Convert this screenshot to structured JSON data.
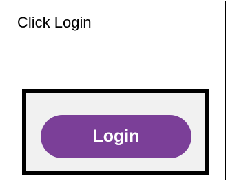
{
  "instruction": {
    "text": "Click Login"
  },
  "login_button": {
    "label": "Login",
    "background_color": "#7b3f98",
    "text_color": "#ffffff"
  },
  "highlight": {
    "frame_color": "#000000",
    "inner_background": "#f1f1f1"
  }
}
